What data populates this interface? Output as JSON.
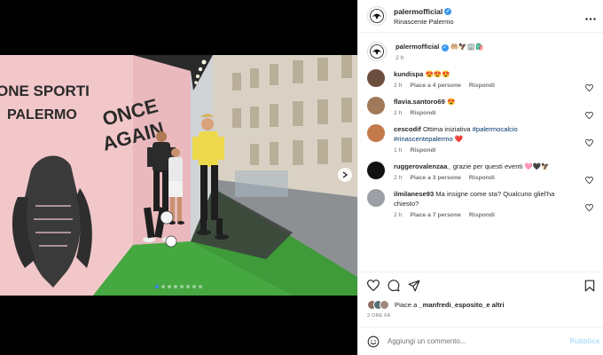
{
  "post": {
    "username": "palermofficial",
    "location": "Rinascente Palermo",
    "caption_emojis": "🤲🏼🦅🏢🛍️",
    "caption_time": "2 h"
  },
  "colors": {
    "accent": "#0095f6",
    "verified": "#3897f0",
    "link": "#00376b",
    "carousel_active": "#3b82f6"
  },
  "carousel": {
    "slides": 8,
    "active": 0
  },
  "comments": [
    {
      "user": "kundispa",
      "text": "😍😍😍",
      "time": "2 h",
      "likes": "Piace a 4 persone",
      "reply": "Rispondi",
      "avatar": "#6b4e3d"
    },
    {
      "user": "flavia.santoro69",
      "text": "😍",
      "time": "2 h",
      "likes": "",
      "reply": "Rispondi",
      "avatar": "#a0785a"
    },
    {
      "user": "cescodif",
      "text": "Ottima iniziativa ",
      "tags": "#palermocalcio #rinascentepalermo",
      "suffix": " ❤️",
      "time": "1 h",
      "likes": "",
      "reply": "Rispondi",
      "avatar": "#c47a4a"
    },
    {
      "user": "ruggerovalenzaa_",
      "text": "grazie per questi eventi 🩷🖤🦅",
      "time": "2 h",
      "likes": "Piace a 3 persone",
      "reply": "Rispondi",
      "avatar": "#111111"
    },
    {
      "user": "ilmilanese93",
      "text": "Ma insigne come sta? Qualcuno gliel'ha chiesto?",
      "time": "2 h",
      "likes": "Piace a 7 persone",
      "reply": "Rispondi",
      "avatar": "#9aa0a6"
    }
  ],
  "likes": {
    "prefix": "Piace a ",
    "user": "_manfredi_esposito_",
    "suffix": " e altri"
  },
  "date": "2 ORE FA",
  "composer": {
    "placeholder": "Aggiungi un commento...",
    "publish": "Pubblica"
  },
  "mural": {
    "line1": "ONE SPORTI",
    "line2": "PALERMO",
    "line3": "ONCE",
    "line4": "AGAIN"
  }
}
